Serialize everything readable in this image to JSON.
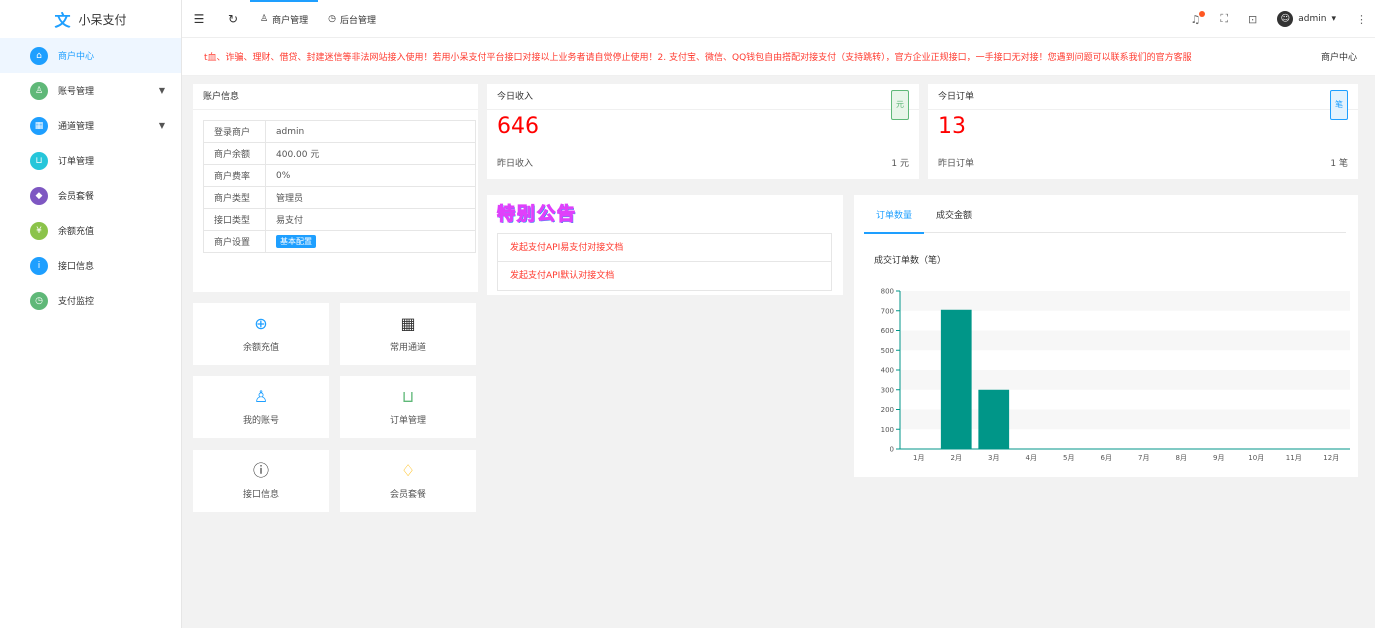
{
  "app": {
    "name": "小呆支付"
  },
  "sidebar": {
    "items": [
      {
        "label": "商户中心",
        "color": "#1e9fff",
        "icon": "home-icon",
        "glyph": "⌂",
        "active": true,
        "arrow": false
      },
      {
        "label": "账号管理",
        "color": "#5fb878",
        "icon": "user-icon",
        "glyph": "♙",
        "active": false,
        "arrow": true
      },
      {
        "label": "通道管理",
        "color": "#1e9fff",
        "icon": "grid-icon",
        "glyph": "▦",
        "active": false,
        "arrow": true
      },
      {
        "label": "订单管理",
        "color": "#26c6da",
        "icon": "cart-icon",
        "glyph": "⊔",
        "active": false,
        "arrow": false
      },
      {
        "label": "会员套餐",
        "color": "#7e57c2",
        "icon": "diamond-icon",
        "glyph": "◆",
        "active": false,
        "arrow": false
      },
      {
        "label": "余额充值",
        "color": "#8bc34a",
        "icon": "yen-icon",
        "glyph": "¥",
        "active": false,
        "arrow": false
      },
      {
        "label": "接口信息",
        "color": "#1e9fff",
        "icon": "info-icon",
        "glyph": "i",
        "active": false,
        "arrow": false
      },
      {
        "label": "支付监控",
        "color": "#5fb878",
        "icon": "monitor-icon",
        "glyph": "◷",
        "active": false,
        "arrow": false
      }
    ]
  },
  "topbar": {
    "tabs": [
      {
        "label": "商户管理",
        "glyph": "♙",
        "active": true
      },
      {
        "label": "后台管理",
        "glyph": "◷",
        "active": false
      }
    ],
    "user": "admin"
  },
  "notice": {
    "text": "t血、诈骗、理财、借贷、封建迷信等非法网站接入使用！若用小呆支付平台接口对接以上业务者请自觉停止使用！2. 支付宝、微信、QQ钱包自由搭配对接支付（支持跳转），官方企业正规接口，一手接口无对接！您遇到问题可以联系我们的官方客服",
    "right": "商户中心"
  },
  "account": {
    "title": "账户信息",
    "rows": [
      {
        "k": "登录商户",
        "v": "admin"
      },
      {
        "k": "商户余额",
        "v": "400.00 元"
      },
      {
        "k": "商户费率",
        "v": "0%"
      },
      {
        "k": "商户类型",
        "v": "管理员"
      },
      {
        "k": "接口类型",
        "v": "易支付"
      },
      {
        "k": "商户设置",
        "v": "基本配置"
      }
    ]
  },
  "tiles": [
    {
      "label": "余额充值",
      "glyph": "⊕",
      "symbol": "¥",
      "color": "#1e9fff",
      "icon": "yen-circle-icon"
    },
    {
      "label": "常用通道",
      "glyph": "▦",
      "symbol": "",
      "color": "#333333",
      "icon": "apps-icon"
    },
    {
      "label": "我的账号",
      "glyph": "♙",
      "symbol": "",
      "color": "#1e9fff",
      "icon": "user-icon"
    },
    {
      "label": "订单管理",
      "glyph": "⊔",
      "symbol": "",
      "color": "#5fb878",
      "icon": "cart-icon"
    },
    {
      "label": "接口信息",
      "glyph": "ⓘ",
      "symbol": "",
      "color": "#333333",
      "icon": "info-icon"
    },
    {
      "label": "会员套餐",
      "glyph": "♢",
      "symbol": "",
      "color": "#ffb800",
      "icon": "diamond-icon"
    }
  ],
  "today_income": {
    "title": "今日收入",
    "badge": "元",
    "value": "646",
    "sub": "昨日收入",
    "sub_value": "1 元"
  },
  "today_orders": {
    "title": "今日订单",
    "badge": "笔",
    "value": "13",
    "sub": "昨日订单",
    "sub_value": "1 笔"
  },
  "announcement": {
    "title": "特别公告",
    "items": [
      "发起支付API易支付对接文档",
      "发起支付API默认对接文档"
    ]
  },
  "chart_tabs": [
    "订单数量",
    "成交金额"
  ],
  "chart_data": {
    "type": "bar",
    "title": "成交订单数（笔）",
    "categories": [
      "1月",
      "2月",
      "3月",
      "4月",
      "5月",
      "6月",
      "7月",
      "8月",
      "9月",
      "10月",
      "11月",
      "12月"
    ],
    "values": [
      0,
      705,
      300,
      0,
      0,
      0,
      0,
      0,
      0,
      0,
      0,
      0
    ],
    "ylim": [
      0,
      800
    ],
    "yticks": [
      0,
      100,
      200,
      300,
      400,
      500,
      600,
      700,
      800
    ],
    "color": "#009688",
    "grid": true
  }
}
